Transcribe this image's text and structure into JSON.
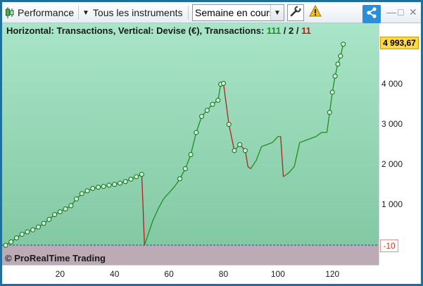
{
  "toolbar": {
    "performance_label": "Performance",
    "instruments_label": "Tous les instruments",
    "period_value": "Semaine en cours",
    "icons": [
      "candlestick-icon",
      "dropdown-arrow-icon",
      "wrench-icon",
      "warning-icon",
      "share-icon",
      "minimize-icon",
      "maximize-icon",
      "close-icon"
    ]
  },
  "header": {
    "prefix": "Horizontal: Transactions, Vertical: Devise (€), Transactions: ",
    "total_transactions": "111",
    "sep1": " / ",
    "middle_count": "2",
    "sep2": " / ",
    "losing_count": "11",
    "total_color": "#1e8f1e",
    "losing_color": "#b02020"
  },
  "watermark": "© ProRealTime Trading",
  "axis": {
    "y_ticks": [
      "4 000",
      "3 000",
      "2 000",
      "1 000"
    ],
    "x_ticks": [
      "20",
      "40",
      "60",
      "80",
      "100",
      "120"
    ],
    "last_value": "4 993,67",
    "zero_label": "-10"
  },
  "chart_data": {
    "type": "line",
    "xlabel": "Transactions",
    "ylabel": "Devise (€)",
    "ylim": [
      -10,
      5400
    ],
    "xlim": [
      0,
      137
    ],
    "up_color": "#1e8f1e",
    "down_color": "#b02020",
    "series": [
      {
        "x": [
          0,
          2,
          4,
          6,
          8,
          10,
          12,
          14,
          16,
          18,
          20,
          22,
          24,
          26,
          28,
          30,
          32,
          34,
          36,
          38,
          40,
          42,
          44,
          46,
          48,
          50,
          51,
          52,
          54,
          56,
          58,
          60,
          62,
          64,
          66,
          68,
          70,
          72,
          74,
          76,
          78,
          79,
          80,
          82,
          84,
          86,
          88,
          89,
          90,
          92,
          94,
          96,
          98,
          100,
          101,
          102,
          104,
          106,
          108,
          110,
          112,
          114,
          116,
          118,
          119,
          120,
          121,
          122,
          123,
          124
        ],
        "y": [
          -5,
          80,
          180,
          270,
          330,
          380,
          450,
          540,
          640,
          760,
          830,
          900,
          980,
          1150,
          1280,
          1350,
          1410,
          1440,
          1460,
          1490,
          1510,
          1540,
          1580,
          1640,
          1700,
          1760,
          -10,
          200,
          600,
          900,
          1150,
          1300,
          1450,
          1650,
          1900,
          2250,
          2800,
          3200,
          3350,
          3500,
          3600,
          4000,
          4020,
          3000,
          2350,
          2500,
          2350,
          1950,
          1900,
          2100,
          2450,
          2500,
          2550,
          2700,
          2700,
          1700,
          1800,
          1950,
          2550,
          2600,
          2650,
          2700,
          2800,
          2800,
          3300,
          3800,
          4200,
          4500,
          4700,
          4993.67
        ]
      }
    ]
  }
}
